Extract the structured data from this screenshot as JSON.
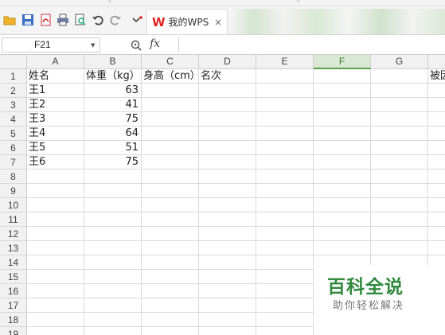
{
  "toolbar": {
    "tab": {
      "logo": "W",
      "label": "我的WPS",
      "close": "×"
    },
    "icons": [
      "open-folder-icon",
      "save-icon",
      "export-pdf-icon",
      "print-icon",
      "print-preview-icon",
      "undo-icon",
      "redo-icon",
      "dropdown-icon"
    ]
  },
  "formula_bar": {
    "cell_ref": "F21",
    "fx": "fx",
    "value": ""
  },
  "sheet": {
    "columns": [
      "A",
      "B",
      "C",
      "D",
      "E",
      "F",
      "G"
    ],
    "active_column": "F",
    "rows": [
      "1",
      "2",
      "3",
      "4",
      "5",
      "6",
      "7",
      "8",
      "9",
      "10",
      "11",
      "12",
      "13",
      "14",
      "15",
      "16",
      "17",
      "18",
      "19"
    ],
    "header_row": {
      "A": "姓名",
      "B": "体重（kg）",
      "C": "身高（cm）",
      "D": "名次",
      "H_partial": "被因"
    },
    "data": [
      {
        "name": "王1",
        "weight": "63"
      },
      {
        "name": "王2",
        "weight": "41"
      },
      {
        "name": "王3",
        "weight": "75"
      },
      {
        "name": "王4",
        "weight": "64"
      },
      {
        "name": "王5",
        "weight": "51"
      },
      {
        "name": "王6",
        "weight": "75"
      }
    ]
  },
  "watermark": {
    "title": "百科全说",
    "subtitle": "助你轻松解决"
  },
  "colors": {
    "accent_green": "#2f8a3e",
    "active_header": "#d9e8d2",
    "wps_red": "#e02323"
  }
}
